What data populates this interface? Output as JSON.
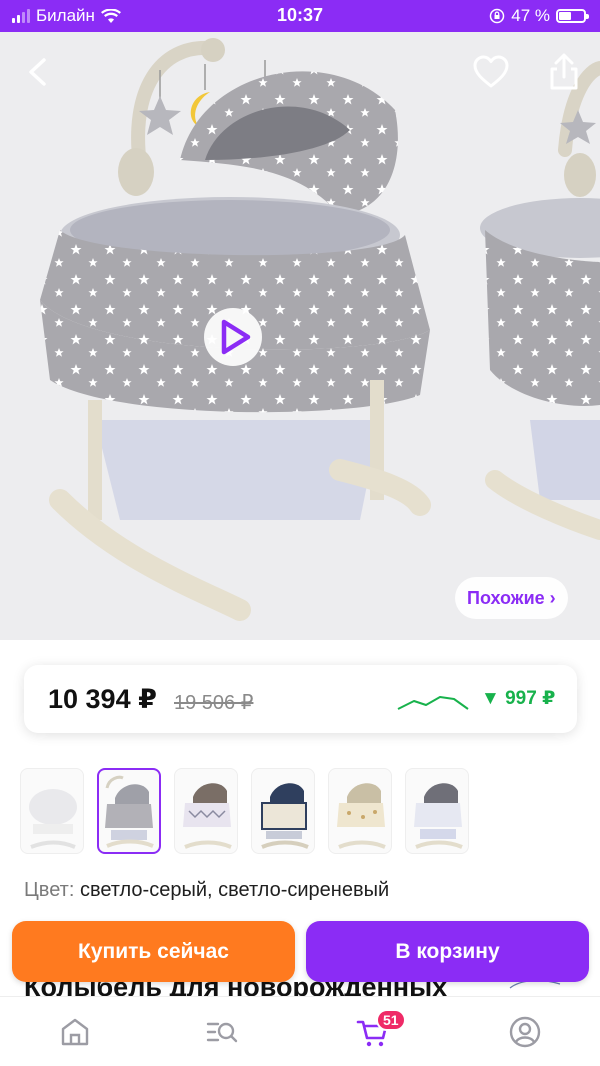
{
  "status_bar": {
    "carrier": "Билайн",
    "time": "10:37",
    "battery": "47 %",
    "battery_level": 0.47
  },
  "hero": {
    "similar_label": "Похожие ›",
    "icons": [
      "back-arrow-icon",
      "heart-icon",
      "share-icon",
      "play-icon"
    ]
  },
  "price": {
    "current": "10 394 ₽",
    "old": "19 506 ₽",
    "drop": "▼ 997 ₽",
    "trend_color": "#18b24c"
  },
  "variants": {
    "selected_index": 1,
    "count": 6
  },
  "color": {
    "label": "Цвет:",
    "value": "светло-серый, светло-сиреневый"
  },
  "actions": {
    "buy_now": "Купить сейчас",
    "add_to_cart": "В корзину",
    "buy_now_color": "#ff7a1f",
    "add_to_cart_color": "#8b2cf5"
  },
  "product": {
    "title": "Колыбель для новорожденных"
  },
  "bottom_nav": {
    "cart_badge": "51",
    "icons": [
      "home-icon",
      "catalog-search-icon",
      "cart-icon",
      "profile-icon"
    ]
  }
}
